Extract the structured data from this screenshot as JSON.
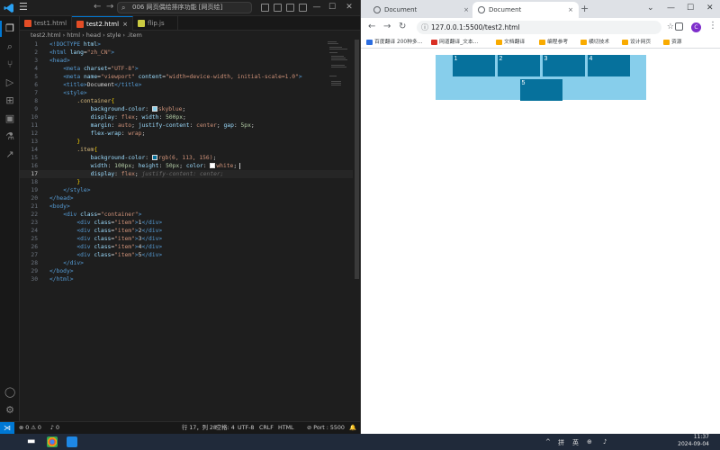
{
  "vscode": {
    "menu_icon": "hamburger-icon",
    "command_center": "006 网页偶绘排序功能 [网页绘]",
    "tabs": [
      {
        "label": "test1.html",
        "active": false
      },
      {
        "label": "test2.html",
        "active": true,
        "close": "×"
      },
      {
        "label": "flip.js",
        "active": false
      }
    ],
    "breadcrumb": [
      "test2.html",
      "html",
      "head",
      "style",
      ".item"
    ],
    "line_numbers": [
      "1",
      "2",
      "3",
      "4",
      "5",
      "6",
      "7",
      "8",
      "9",
      "10",
      "11",
      "12",
      "13",
      "14",
      "15",
      "16",
      "17",
      "18",
      "19",
      "20",
      "21",
      "22",
      "23",
      "24",
      "25",
      "26",
      "27",
      "28",
      "29",
      "30"
    ],
    "code": {
      "l1": [
        "<!DOCTYPE",
        " html",
        ">"
      ],
      "l2": [
        "<html",
        " lang",
        "=",
        "\"zh_CN\"",
        ">"
      ],
      "l3": [
        "<head>"
      ],
      "l4": [
        "<meta",
        " charset",
        "=",
        "\"UTF-8\"",
        ">"
      ],
      "l5": [
        "<meta",
        " name",
        "=",
        "\"viewport\"",
        " content",
        "=",
        "\"width=device-width, initial-scale=1.0\"",
        ">"
      ],
      "l6": [
        "<title>",
        "Document",
        "</title>"
      ],
      "l7": [
        "<style>"
      ],
      "l8": [
        ".container",
        "{"
      ],
      "l9": [
        "background-color",
        ": ",
        "skyblue",
        ";"
      ],
      "l10": [
        "display",
        ": ",
        "flex",
        "; ",
        "width",
        ": ",
        "500px",
        ";"
      ],
      "l11": [
        "margin",
        ": ",
        "auto",
        "; ",
        "justify-content",
        ": ",
        "center",
        "; ",
        "gap",
        ": ",
        "5px",
        ";"
      ],
      "l12": [
        "flex-wrap",
        ": ",
        "wrap",
        ";"
      ],
      "l13": [
        "}"
      ],
      "l14": [
        ".item",
        "{"
      ],
      "l15": [
        "background-color",
        ": ",
        "rgb(6, 113, 156)",
        ";"
      ],
      "l16": [
        "width",
        ": ",
        "100px",
        "; ",
        "height",
        ": ",
        "50px",
        "; ",
        "color",
        ": ",
        "white",
        ";"
      ],
      "l17": [
        "display",
        ": ",
        "flex",
        "; ",
        "justify-content: center;"
      ],
      "l18": [
        "}"
      ],
      "l19": [
        "</style>"
      ],
      "l20": [
        "</head>"
      ],
      "l21": [
        "<body>"
      ],
      "l22": [
        "<div",
        " class",
        "=",
        "\"container\"",
        ">"
      ],
      "l23": [
        "<div",
        " class",
        "=",
        "\"item\"",
        ">",
        "1",
        "</div>"
      ],
      "l24": [
        "<div",
        " class",
        "=",
        "\"item\"",
        ">",
        "2",
        "</div>"
      ],
      "l25": [
        "<div",
        " class",
        "=",
        "\"item\"",
        ">",
        "3",
        "</div>"
      ],
      "l26": [
        "<div",
        " class",
        "=",
        "\"item\"",
        ">",
        "4",
        "</div>"
      ],
      "l27": [
        "<div",
        " class",
        "=",
        "\"item\"",
        ">",
        "5",
        "</div>"
      ],
      "l28": [
        "</div>"
      ],
      "l29": [
        "</body>"
      ],
      "l30": [
        "</html>"
      ]
    },
    "swatch_colors": {
      "skyblue": "#87ceeb",
      "rgb": "#06719c",
      "white": "#ffffff"
    },
    "statusbar": {
      "errors": "⊗ 0 ⚠ 0",
      "ports": "♪ 0",
      "position": "行 17，列 28",
      "spaces": "空格: 4",
      "encoding": "UTF-8",
      "eol": "CRLF",
      "language": "HTML",
      "port": "⊘ Port : 5500"
    }
  },
  "browser": {
    "tabs": [
      {
        "label": "Document",
        "active": false,
        "close": "×"
      },
      {
        "label": "Document",
        "active": true,
        "close": "×"
      }
    ],
    "new_tab": "+",
    "window_controls": [
      "⌄",
      "—",
      "☐",
      "✕"
    ],
    "url": "127.0.0.1:5500/test2.html",
    "avatar": "C",
    "bookmarks": [
      {
        "label": "百度翻译 200种多...",
        "color": "#2b6de0"
      },
      {
        "label": "网道翻译_文本...",
        "color": "#d93025"
      },
      {
        "label": "文档翻译",
        "color": "#f9ab00"
      },
      {
        "label": "编程参考",
        "color": "#f9ab00"
      },
      {
        "label": "横切技术",
        "color": "#f9ab00"
      },
      {
        "label": "设计网页",
        "color": "#f9ab00"
      },
      {
        "label": "资源",
        "color": "#f9ab00"
      }
    ],
    "demo": {
      "container_color": "#87ceeb",
      "item_color": "#06719c",
      "items": [
        "1",
        "2",
        "3",
        "4",
        "5"
      ]
    }
  },
  "taskbar": {
    "time": "11:37",
    "date": "2024-09-04",
    "ime": "英",
    "tray_labels": [
      "^",
      "拼",
      "⊕"
    ]
  }
}
